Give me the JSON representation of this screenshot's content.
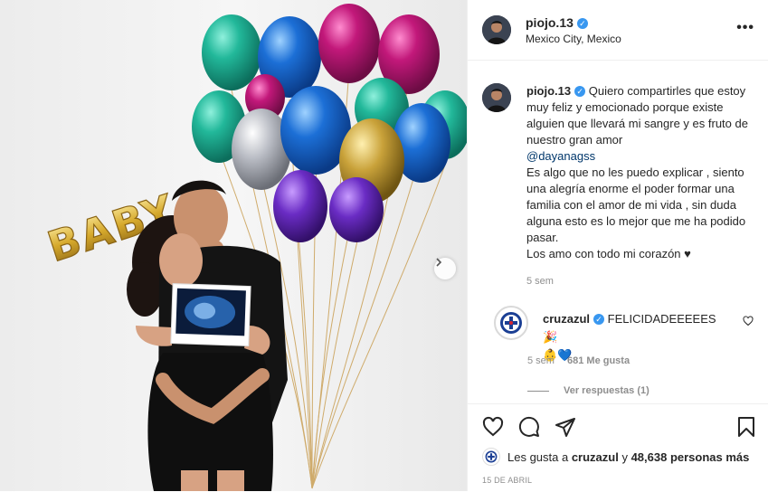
{
  "header": {
    "username": "piojo.13",
    "location": "Mexico City, Mexico",
    "more_icon": "more-horizontal-icon"
  },
  "media": {
    "balloon_text": "BABY",
    "next_icon": "chevron-right-icon"
  },
  "caption": {
    "username": "piojo.13",
    "line1": "Quiero compartirles que estoy muy feliz y emocionado porque existe alguien que llevará mi sangre y es fruto de nuestro gran amor",
    "mention": "@dayanagss",
    "line2": "Es algo que no les puedo explicar , siento una alegría enorme el poder formar una familia con el amor de mi vida , sin duda alguna esto es lo mejor que me ha podido pasar.",
    "line3": "Los amo con todo mi corazón ♥",
    "time": "5 sem"
  },
  "comment": {
    "username": "cruzazul",
    "text": "FELICIDADEEEEES 🎉",
    "emojis": "👶💙",
    "time": "5 sem",
    "likes": "681 Me gusta",
    "view_replies": "Ver respuestas (1)"
  },
  "actions": {
    "like_icon": "heart-icon",
    "comment_icon": "comment-icon",
    "share_icon": "share-icon",
    "save_icon": "bookmark-icon"
  },
  "likes": {
    "prefix": "Les gusta a ",
    "user": "cruzazul",
    "middle": " y ",
    "count": "48,638 personas más"
  },
  "date": "15 DE ABRIL",
  "colors": {
    "verified": "#3897f0",
    "mention": "#00376b",
    "meta": "#8e8e8e",
    "cruzazul_blue": "#1b3f94"
  }
}
